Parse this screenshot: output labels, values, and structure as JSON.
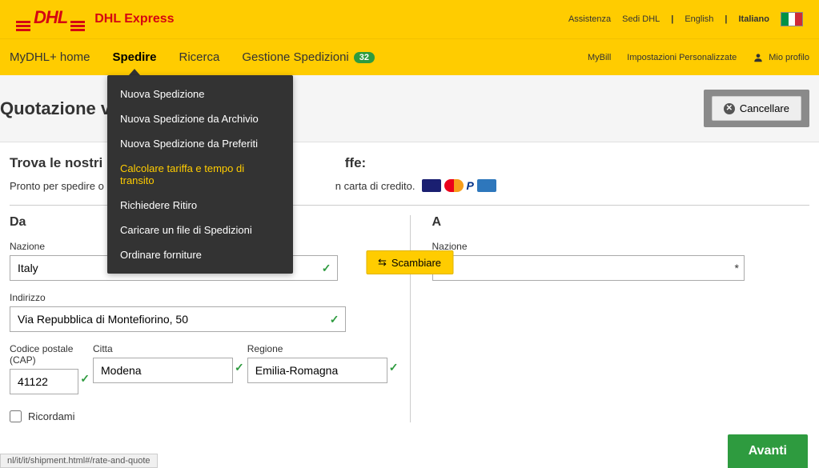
{
  "topbar": {
    "brand": "DHL Express",
    "links": {
      "help": "Assistenza",
      "locations": "Sedi DHL",
      "lang_en": "English",
      "lang_it": "Italiano"
    }
  },
  "nav": {
    "home": "MyDHL+ home",
    "ship": "Spedire",
    "search": "Ricerca",
    "manage": "Gestione Spedizioni",
    "badge": "32",
    "mybill": "MyBill",
    "settings": "Impostazioni Personalizzate",
    "profile": "Mio profilo"
  },
  "dropdown": {
    "items": [
      {
        "label": "Nuova Spedizione",
        "highlight": false
      },
      {
        "label": "Nuova Spedizione da Archivio",
        "highlight": false
      },
      {
        "label": "Nuova Spedizione da Preferiti",
        "highlight": false
      },
      {
        "label": "Calcolare tariffa e tempo di transito",
        "highlight": true
      },
      {
        "label": "Richiedere Ritiro",
        "highlight": false
      },
      {
        "label": "Caricare un file di Spedizioni",
        "highlight": false
      },
      {
        "label": "Ordinare forniture",
        "highlight": false
      }
    ]
  },
  "page": {
    "title": "Quotazione ve",
    "cancel": "Cancellare",
    "section_title": "Trova le nostri",
    "section_title_suffix": "ffe:",
    "desc_prefix": "Pronto per spedire o",
    "desc_suffix": "n carta di credito."
  },
  "form": {
    "from_title": "Da",
    "to_title": "A",
    "swap": "Scambiare",
    "country_label": "Nazione",
    "country_value": "Italy",
    "address_label": "Indirizzo",
    "address_value": "Via Repubblica di Montefiorino, 50",
    "postal_label": "Codice postale (CAP)",
    "postal_value": "41122",
    "city_label": "Citta",
    "city_value": "Modena",
    "region_label": "Regione",
    "region_value": "Emilia-Romagna",
    "remember": "Ricordami",
    "to_country_value": ""
  },
  "footer": {
    "next": "Avanti",
    "url": "nl/it/it/shipment.html#/rate-and-quote"
  }
}
